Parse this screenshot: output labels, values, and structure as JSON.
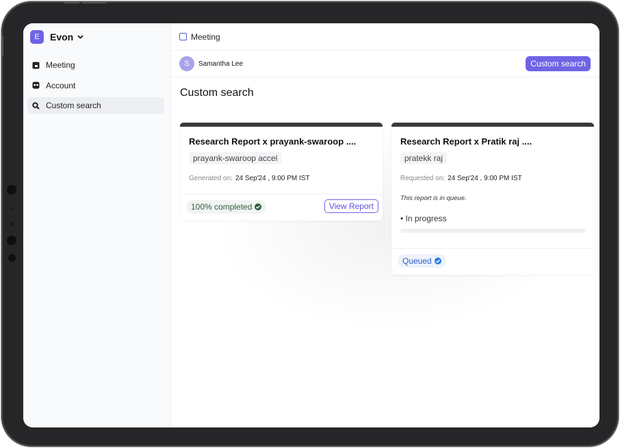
{
  "workspace": {
    "initial": "E",
    "name": "Evon",
    "chevron_icon": "chevron-down-icon"
  },
  "sidebar": {
    "items": [
      {
        "label": "Meeting",
        "icon": "meeting-icon",
        "active": false
      },
      {
        "label": "Account",
        "icon": "account-icon",
        "active": false
      },
      {
        "label": "Custom search",
        "icon": "search-icon",
        "active": true
      }
    ]
  },
  "header": {
    "breadcrumb": "Meeting",
    "breadcrumb_icon": "meeting-square-icon"
  },
  "user": {
    "initial": "S",
    "name": "Samantha Lee"
  },
  "toolbar": {
    "custom_search_button": "Custom search"
  },
  "page": {
    "title": "Custom search"
  },
  "reports": [
    {
      "title": "Research Report x prayank-swaroop ....",
      "tag": "prayank-swaroop accel",
      "meta_label": "Generated on:",
      "meta_value": "24 Sep'24 , 9:00 PM IST",
      "status": "100% completed",
      "status_icon": "check-circle-icon",
      "action": "View Report"
    },
    {
      "title": "Research Report x  Pratik raj ....",
      "tag": "pratekk raj",
      "meta_label": "Requested on:",
      "meta_value": "24 Sep'24 , 9:00 PM IST",
      "note": "This report is in queue.",
      "progress_label": "• In progress",
      "progress": 0,
      "status": "Queued",
      "status_icon": "check-circle-icon"
    }
  ],
  "colors": {
    "accent": "#6f63e6",
    "frame": "#262628",
    "completed_text": "#2d5e3f",
    "queued_text": "#2b63c6"
  }
}
